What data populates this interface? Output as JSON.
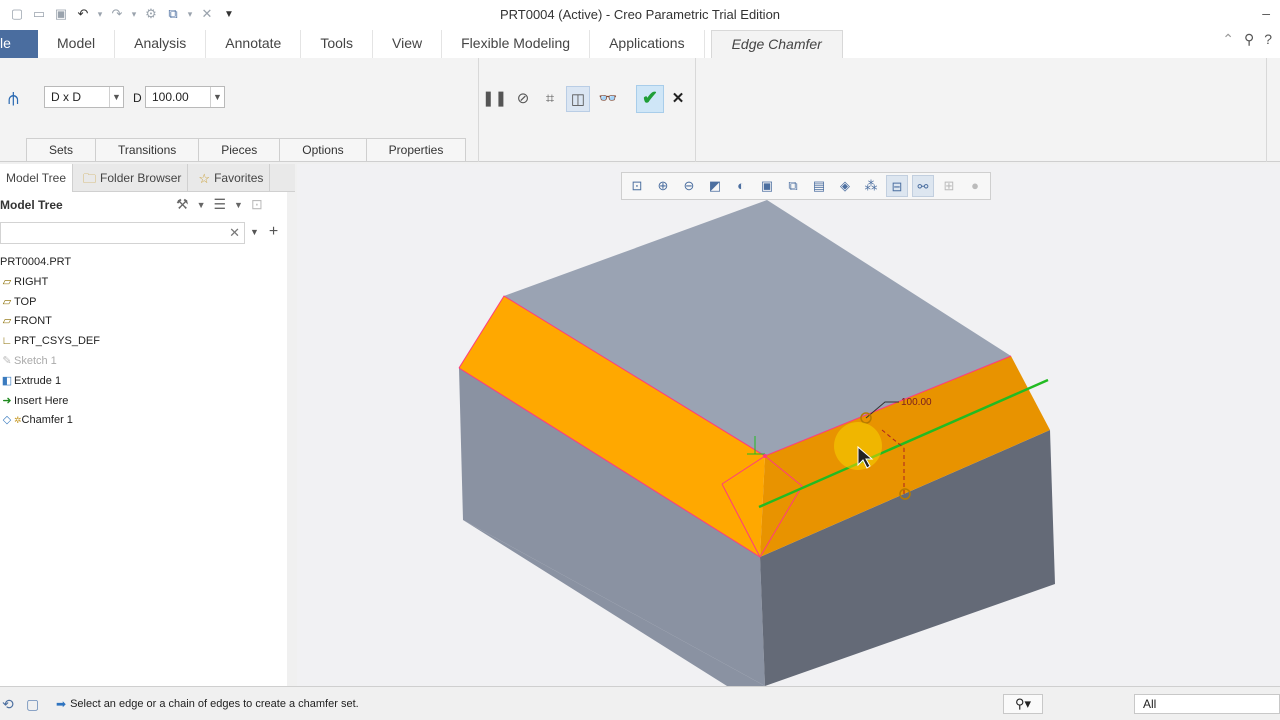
{
  "window": {
    "title": "PRT0004 (Active) - Creo Parametric Trial Edition",
    "min_icon": "minimize-icon",
    "max_icon": "maximize-icon"
  },
  "quick_access": [
    "new-icon",
    "open-icon",
    "save-icon",
    "undo-icon",
    "redo-icon",
    "regenerate-icon",
    "windows-icon",
    "close-window-icon"
  ],
  "tabs": {
    "file": "le",
    "items": [
      "Model",
      "Analysis",
      "Annotate",
      "Tools",
      "View",
      "Flexible Modeling",
      "Applications"
    ],
    "active": "Edge Chamfer"
  },
  "ribbon": {
    "dim_scheme": "D x D",
    "d_label": "D",
    "d_value": "100.00",
    "subtabs": [
      "Sets",
      "Transitions",
      "Pieces",
      "Options",
      "Properties"
    ]
  },
  "panel": {
    "tabs": [
      "Model Tree",
      "Folder Browser",
      "Favorites"
    ],
    "heading": "Model Tree",
    "search_value": "",
    "tree": [
      {
        "label": "PRT0004.PRT",
        "icon": "part-icon",
        "dim": false
      },
      {
        "label": "RIGHT",
        "icon": "datum-plane-icon",
        "dim": false
      },
      {
        "label": "TOP",
        "icon": "datum-plane-icon",
        "dim": false
      },
      {
        "label": "FRONT",
        "icon": "datum-plane-icon",
        "dim": false
      },
      {
        "label": "PRT_CSYS_DEF",
        "icon": "csys-icon",
        "dim": false
      },
      {
        "label": "Sketch 1",
        "icon": "sketch-icon",
        "dim": true
      },
      {
        "label": "Extrude 1",
        "icon": "extrude-icon",
        "dim": false
      },
      {
        "label": "Insert Here",
        "icon": "insert-arrow-icon",
        "dim": false
      },
      {
        "label": "Chamfer 1",
        "icon": "chamfer-icon",
        "dim": false
      }
    ]
  },
  "viewport": {
    "dimension_label": "100.00"
  },
  "status": {
    "message": "Select an edge or a chain of edges to create a chamfer set.",
    "filter_value": "All"
  },
  "colors": {
    "file_tab": "#4a6d9f",
    "chamfer_face": "#ffa500",
    "chamfer_face_dark": "#e08d00",
    "solid_top": "#9aa3b3",
    "solid_left": "#8a92a2",
    "solid_right": "#6a707c",
    "edge_highlight": "#ff3b7f",
    "selection_line": "#22bb22",
    "ok_green": "#1f9e37"
  }
}
